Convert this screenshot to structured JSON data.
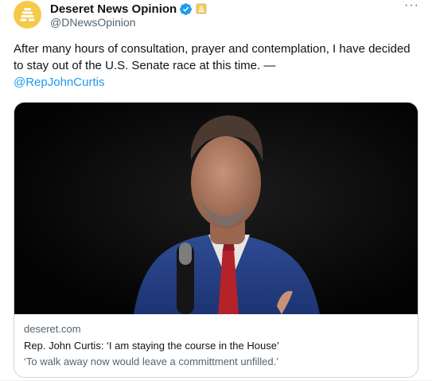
{
  "account": {
    "display_name": "Deseret News Opinion",
    "handle": "@DNewsOpinion",
    "avatar_icon": "beehive-logo-icon",
    "verified_icon": "verified-badge-icon",
    "affiliate_icon": "affiliate-badge-icon",
    "avatar_color": "#f6c94a",
    "verified_color": "#1d9bf0"
  },
  "menu": {
    "more_label": "···"
  },
  "tweet": {
    "text": "After many hours of consultation, prayer and contemplation, I have decided to stay out of the U.S. Senate race at this time. —",
    "mention": "@RepJohnCurtis",
    "mention_color": "#1d9bf0"
  },
  "link_card": {
    "image_description_icon": "article-photo-icon",
    "domain": "deseret.com",
    "title": "Rep. John Curtis: ‘I am staying the course in the House’",
    "description": "‘To walk away now would leave a committment unfilled.’"
  }
}
